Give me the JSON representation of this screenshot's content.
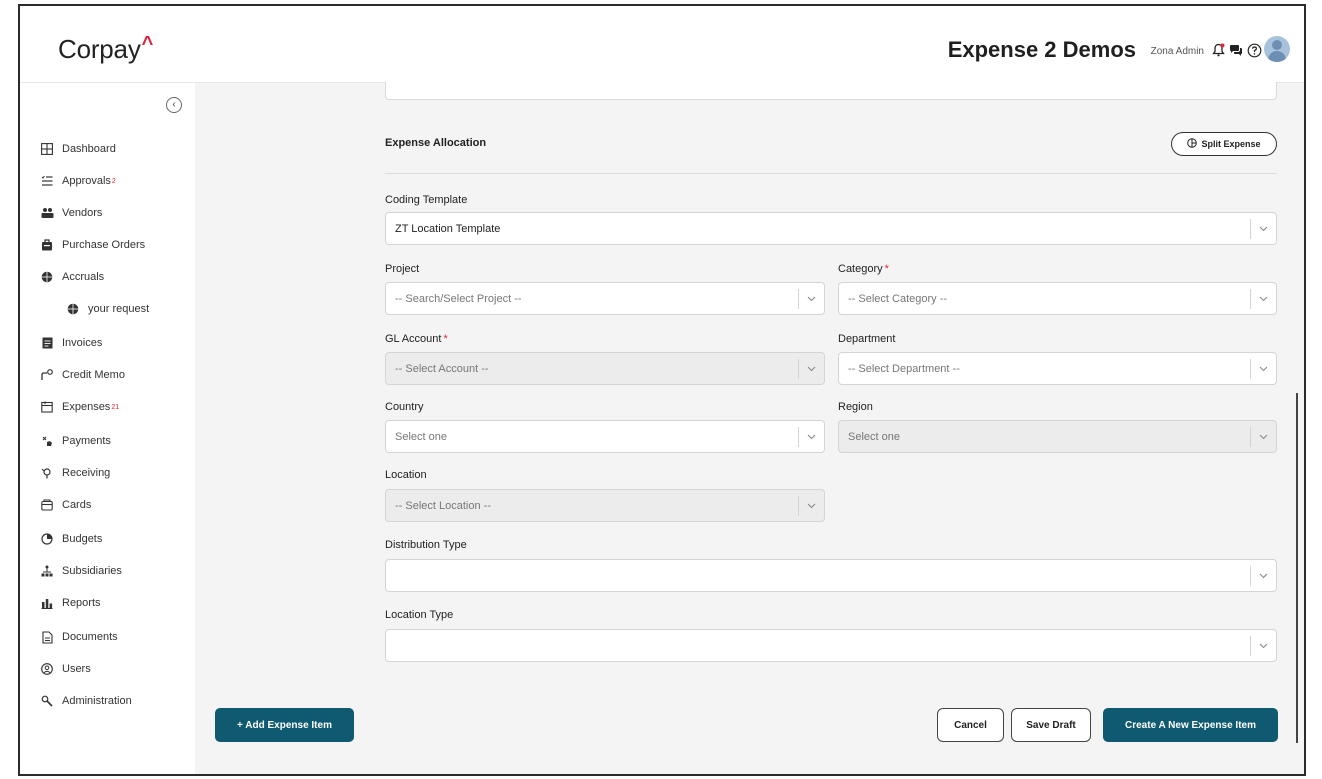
{
  "header": {
    "logo": "Corpay",
    "logo_mark": "^",
    "app_title": "Expense 2 Demos",
    "user_name": "Zona Admin",
    "icons": [
      "bell-icon",
      "chat-icon",
      "help-icon",
      "avatar-icon"
    ]
  },
  "sidebar": {
    "collapse_icon": "chevron-left-icon",
    "items": [
      {
        "label": "Dashboard",
        "icon": "dashboard-icon",
        "badge": ""
      },
      {
        "label": "Approvals",
        "icon": "approvals-icon",
        "badge": "2"
      },
      {
        "label": "Vendors",
        "icon": "vendors-icon",
        "badge": ""
      },
      {
        "label": "Purchase Orders",
        "icon": "purchase-orders-icon",
        "badge": ""
      },
      {
        "label": "Accruals",
        "icon": "accruals-icon",
        "badge": ""
      },
      {
        "label": "your request",
        "icon": "accruals-icon",
        "badge": ""
      },
      {
        "label": "Invoices",
        "icon": "invoices-icon",
        "badge": ""
      },
      {
        "label": "Credit Memo",
        "icon": "credit-memo-icon",
        "badge": ""
      },
      {
        "label": "Expenses",
        "icon": "expenses-icon",
        "badge": "21"
      },
      {
        "label": "Payments",
        "icon": "payments-icon",
        "badge": ""
      },
      {
        "label": "Receiving",
        "icon": "receiving-icon",
        "badge": ""
      },
      {
        "label": "Cards",
        "icon": "cards-icon",
        "badge": ""
      },
      {
        "label": "Budgets",
        "icon": "budgets-icon",
        "badge": ""
      },
      {
        "label": "Subsidiaries",
        "icon": "subsidiaries-icon",
        "badge": ""
      },
      {
        "label": "Reports",
        "icon": "reports-icon",
        "badge": ""
      },
      {
        "label": "Documents",
        "icon": "documents-icon",
        "badge": ""
      },
      {
        "label": "Users",
        "icon": "users-icon",
        "badge": ""
      },
      {
        "label": "Administration",
        "icon": "administration-icon",
        "badge": ""
      }
    ]
  },
  "form": {
    "section_title": "Expense Allocation",
    "split_button": "Split Expense",
    "coding_template": {
      "label": "Coding Template",
      "value": "ZT Location Template"
    },
    "project": {
      "label": "Project",
      "placeholder": "-- Search/Select Project --"
    },
    "category": {
      "label": "Category",
      "required": "*",
      "placeholder": "-- Select Category --"
    },
    "gl_account": {
      "label": "GL Account",
      "required": "*",
      "placeholder": "-- Select Account --"
    },
    "department": {
      "label": "Department",
      "placeholder": "-- Select Department --"
    },
    "country": {
      "label": "Country",
      "placeholder": "Select one"
    },
    "region": {
      "label": "Region",
      "placeholder": "Select one"
    },
    "location": {
      "label": "Location",
      "placeholder": "-- Select Location --"
    },
    "distribution_type": {
      "label": "Distribution Type",
      "value": ""
    },
    "location_type": {
      "label": "Location Type",
      "value": ""
    }
  },
  "actions": {
    "add_item": "+ Add Expense Item",
    "cancel": "Cancel",
    "save_draft": "Save Draft",
    "create_new": "Create A New Expense Item"
  },
  "colors": {
    "primary": "#0f5a70",
    "accent": "#e0233a",
    "background": "#f4f4f4"
  }
}
